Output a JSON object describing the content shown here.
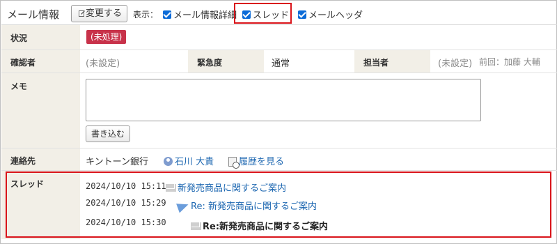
{
  "header": {
    "title": "メール情報",
    "change_button": "変更する",
    "display_label": "表示：",
    "options": [
      {
        "label": "メール情報詳細",
        "checked": true
      },
      {
        "label": "スレッド",
        "checked": true
      },
      {
        "label": "メールヘッダ",
        "checked": true
      }
    ]
  },
  "status": {
    "label": "状況",
    "badge": "(未処理)"
  },
  "confirmer": {
    "label": "確認者",
    "value": "(未設定)",
    "urgency_label": "緊急度",
    "urgency_value": "通常",
    "assignee_label": "担当者",
    "assignee_value": "(未設定)",
    "assignee_prev": "前回：加藤 大輔"
  },
  "memo": {
    "label": "メモ",
    "value": "",
    "write_button": "書き込む"
  },
  "contact": {
    "label": "連絡先",
    "company": "キントーン銀行",
    "person": "石川 大貴",
    "history_link": "履歴を見る"
  },
  "thread": {
    "label": "スレッド",
    "items": [
      {
        "date": "2024/10/10 15:11",
        "subject": "新発売商品に関するご案内"
      },
      {
        "date": "2024/10/10 15:29",
        "subject": "Re: 新発売商品に関するご案内"
      },
      {
        "date": "2024/10/10 15:30",
        "subject": "Re:新発売商品に関するご案内"
      }
    ]
  },
  "colors": {
    "accent_red": "#d9141b",
    "badge": "#c8324a",
    "link": "#1d67b1",
    "label_bg": "#f2efe7",
    "checkbox": "#0b6bd8"
  }
}
